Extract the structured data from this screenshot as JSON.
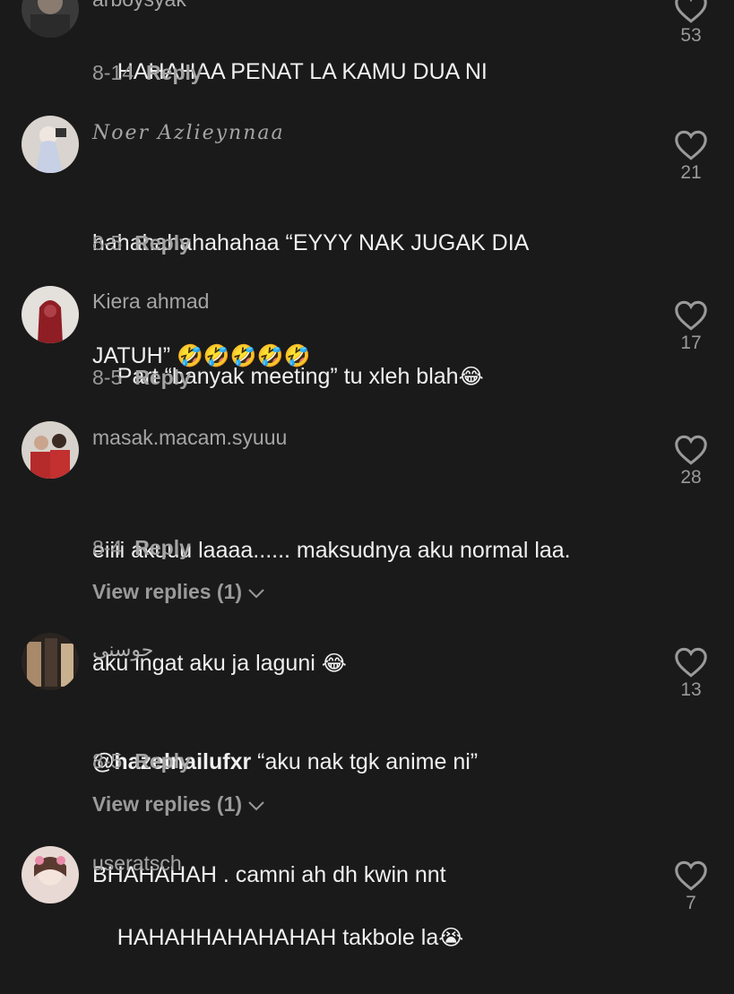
{
  "comments": [
    {
      "username": "arboysyak",
      "text": "HAHAHAA PENAT LA KAMU DUA NI",
      "date": "8-14",
      "reply_label": "Reply",
      "likes": "53"
    },
    {
      "username": "Noer Azlieynnaa",
      "text_line1": "hahahahahahahaa “EYYY NAK JUGAK DIA",
      "text_line2": "JATUH” ",
      "emoji": "🤣🤣🤣🤣🤣",
      "date": "8-5",
      "reply_label": "Reply",
      "likes": "21"
    },
    {
      "username": "Kiera ahmad",
      "text": "Part “banyak meeting” tu xleh blah",
      "emoji": "😂",
      "date": "8-5",
      "reply_label": "Reply",
      "likes": "17"
    },
    {
      "username": "masak.macam.syuuu",
      "text_line1": "eiiii akuuu laaaa...... maksudnya aku normal laa.",
      "text_line2": "aku ingat aku ja laguni ",
      "emoji": "😂",
      "date": "8-4",
      "reply_label": "Reply",
      "view_replies": "View replies (1)",
      "likes": "28"
    },
    {
      "username": "حوسنى",
      "mention": "@hazelnailufxr",
      "text_line1_rest": " “aku nak tgk anime ni”",
      "text_line2": "BHAHAHAH . camni ah dh kwin nnt",
      "date": "8-5",
      "reply_label": "Reply",
      "view_replies": "View replies (1)",
      "likes": "13"
    },
    {
      "username": "useratsch",
      "text": "HAHAHHAHAHAHAH takbole la",
      "emoji": "😭",
      "likes": "7"
    }
  ]
}
